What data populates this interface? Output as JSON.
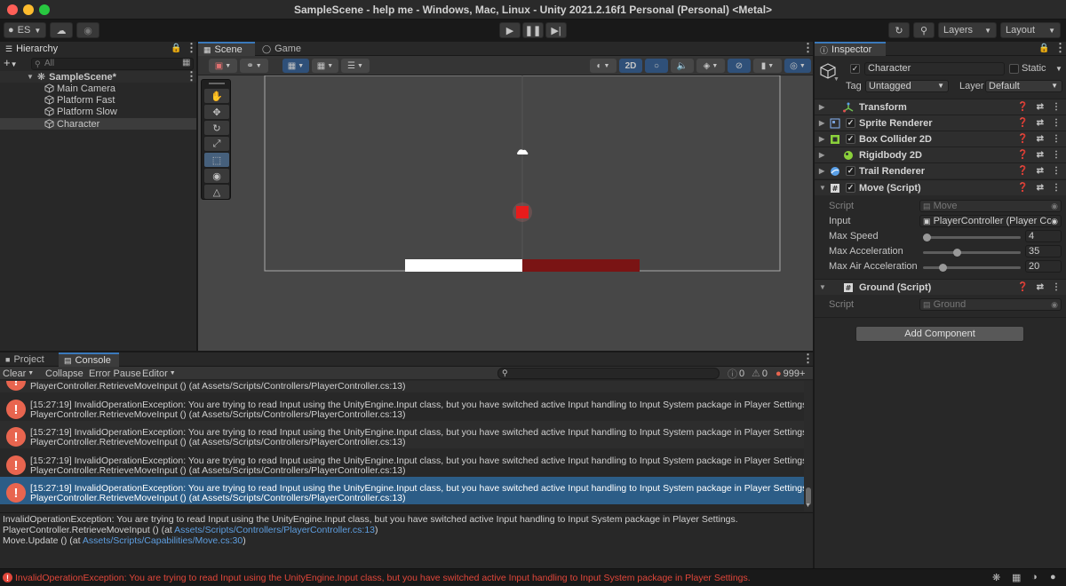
{
  "window": {
    "title": "SampleScene - help me - Windows, Mac, Linux - Unity 2021.2.16f1 Personal (Personal) <Metal>"
  },
  "toolbar": {
    "account": "ES",
    "layers_label": "Layers",
    "layout_label": "Layout"
  },
  "hierarchy": {
    "tab_label": "Hierarchy",
    "search_placeholder": "All",
    "scene_name": "SampleScene*",
    "items": [
      "Main Camera",
      "Platform Fast",
      "Platform Slow",
      "Character"
    ],
    "selected": "Character"
  },
  "scene": {
    "tab_scene": "Scene",
    "tab_game": "Game",
    "mode_2d": "2D"
  },
  "inspector": {
    "tab_label": "Inspector",
    "object_name": "Character",
    "static_label": "Static",
    "tag_label": "Tag",
    "tag_value": "Untagged",
    "layer_label": "Layer",
    "layer_value": "Default",
    "components": [
      {
        "name": "Transform",
        "icon": "transform-icon"
      },
      {
        "name": "Sprite Renderer",
        "icon": "sprite-renderer-icon"
      },
      {
        "name": "Box Collider 2D",
        "icon": "box-collider-icon"
      },
      {
        "name": "Rigidbody 2D",
        "icon": "rigidbody-icon"
      },
      {
        "name": "Trail Renderer",
        "icon": "trail-renderer-icon"
      },
      {
        "name": "Move (Script)",
        "icon": "script-icon"
      }
    ],
    "move": {
      "script_label": "Script",
      "script_value": "Move",
      "input_label": "Input",
      "input_value": "PlayerController (Player Con",
      "max_speed_label": "Max Speed",
      "max_speed_value": "4",
      "max_speed_fraction": 0.04,
      "max_accel_label": "Max Acceleration",
      "max_accel_value": "35",
      "max_accel_fraction": 0.35,
      "max_air_accel_label": "Max Air Acceleration",
      "max_air_accel_value": "20",
      "max_air_accel_fraction": 0.2
    },
    "ground": {
      "name": "Ground (Script)",
      "script_label": "Script",
      "script_value": "Ground"
    },
    "add_component": "Add Component"
  },
  "console": {
    "tab_project": "Project",
    "tab_console": "Console",
    "clear": "Clear",
    "collapse": "Collapse",
    "error_pause": "Error Pause",
    "editor": "Editor",
    "count_info": "0",
    "count_warn": "0",
    "count_error": "999+",
    "partial_line": "PlayerController.RetrieveMoveInput () (at Assets/Scripts/Controllers/PlayerController.cs:13)",
    "entries": [
      {
        "line1": "[15:27:19] InvalidOperationException: You are trying to read Input using the UnityEngine.Input class, but you have switched active Input handling to Input System package in Player Settings.",
        "line2": "PlayerController.RetrieveMoveInput () (at Assets/Scripts/Controllers/PlayerController.cs:13)"
      },
      {
        "line1": "[15:27:19] InvalidOperationException: You are trying to read Input using the UnityEngine.Input class, but you have switched active Input handling to Input System package in Player Settings.",
        "line2": "PlayerController.RetrieveMoveInput () (at Assets/Scripts/Controllers/PlayerController.cs:13)"
      },
      {
        "line1": "[15:27:19] InvalidOperationException: You are trying to read Input using the UnityEngine.Input class, but you have switched active Input handling to Input System package in Player Settings.",
        "line2": "PlayerController.RetrieveMoveInput () (at Assets/Scripts/Controllers/PlayerController.cs:13)"
      },
      {
        "line1": "[15:27:19] InvalidOperationException: You are trying to read Input using the UnityEngine.Input class, but you have switched active Input handling to Input System package in Player Settings.",
        "line2": "PlayerController.RetrieveMoveInput () (at Assets/Scripts/Controllers/PlayerController.cs:13)"
      }
    ],
    "detail": {
      "line1": "InvalidOperationException: You are trying to read Input using the UnityEngine.Input class, but you have switched active Input handling to Input System package in Player Settings.",
      "line2_prefix": "PlayerController.RetrieveMoveInput () (at ",
      "line2_link": "Assets/Scripts/Controllers/PlayerController.cs:13",
      "line2_suffix": ")",
      "line3_prefix": "Move.Update () (at ",
      "line3_link": "Assets/Scripts/Capabilities/Move.cs:30",
      "line3_suffix": ")"
    }
  },
  "statusbar": {
    "message": "InvalidOperationException: You are trying to read Input using the UnityEngine.Input class, but you have switched active Input handling to Input System package in Player Settings."
  },
  "colors": {
    "accent": "#3a79bb",
    "error": "#e8654f",
    "selection": "#2c5d87",
    "link": "#5e9ee0",
    "status_error": "#e0463a"
  }
}
